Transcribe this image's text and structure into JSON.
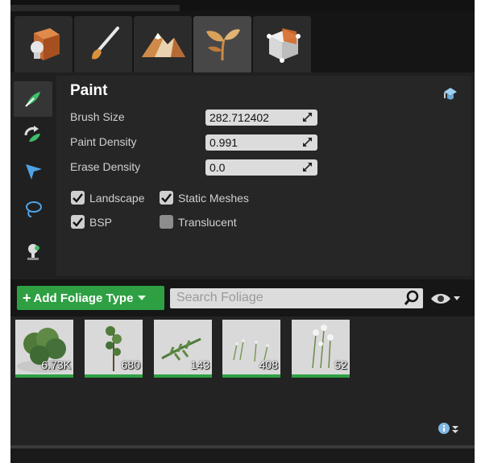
{
  "paint": {
    "title": "Paint",
    "brush_size_label": "Brush Size",
    "brush_size_value": "282.712402",
    "paint_density_label": "Paint Density",
    "paint_density_value": "0.991",
    "erase_density_label": "Erase Density",
    "erase_density_value": "0.0"
  },
  "filters": [
    {
      "label": "Landscape",
      "checked": true
    },
    {
      "label": "Static Meshes",
      "checked": true
    },
    {
      "label": "BSP",
      "checked": true
    },
    {
      "label": "Translucent",
      "checked": false
    }
  ],
  "foliage": {
    "add_label": "Add Foliage Type",
    "search_placeholder": "Search Foliage",
    "types": [
      {
        "count": "6.73K"
      },
      {
        "count": "680"
      },
      {
        "count": "143"
      },
      {
        "count": "408"
      },
      {
        "count": "52"
      }
    ]
  },
  "mode_tabs": [
    "place-mode-icon",
    "paint-mode-icon",
    "landscape-mode-icon",
    "foliage-mode-icon",
    "geometry-mode-icon"
  ],
  "tools": [
    "paint-tool-icon",
    "reapply-tool-icon",
    "select-tool-icon",
    "lasso-tool-icon",
    "fill-tool-icon"
  ],
  "colors": {
    "accent_green": "#2ea043",
    "panel_bg": "#262626",
    "field_bg": "#dcdcdc"
  }
}
